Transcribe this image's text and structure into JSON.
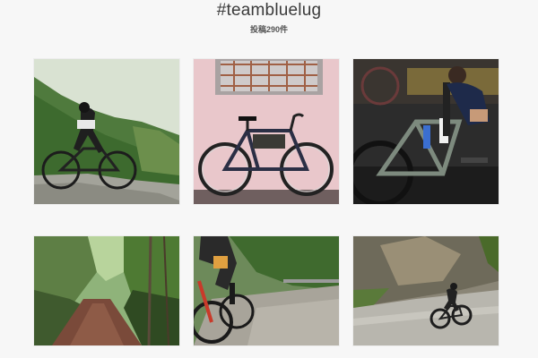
{
  "header": {
    "hashtag": "#teambluelug",
    "post_count": "投稿290件"
  },
  "posts": [
    {
      "label": "cyclist-forest-dirt-road"
    },
    {
      "label": "bike-pink-wall"
    },
    {
      "label": "bike-repair-stand"
    },
    {
      "label": "forest-path"
    },
    {
      "label": "cyclist-gravel-climb"
    },
    {
      "label": "cyclist-mountain-road"
    }
  ],
  "colors": {
    "background": "#f7f7f7",
    "text": "#3b3b3b"
  }
}
